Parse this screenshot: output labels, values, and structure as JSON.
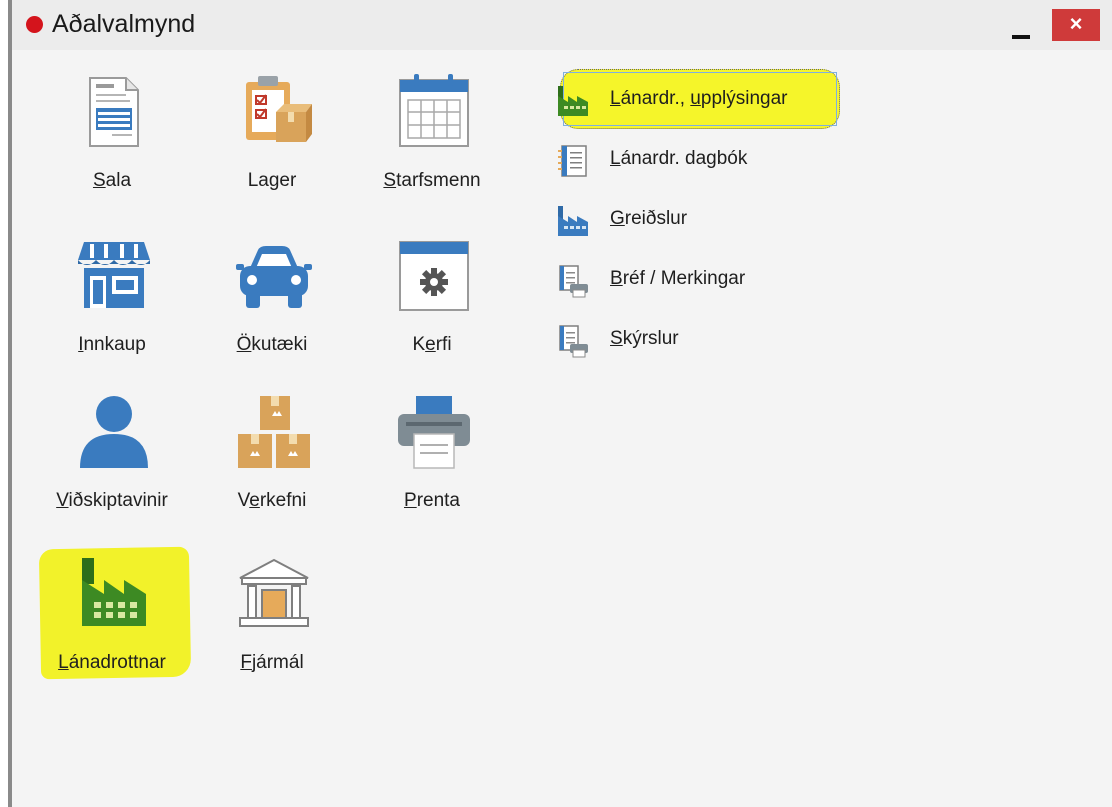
{
  "window": {
    "title": "Aðalvalmynd",
    "minimize_label": "–",
    "close_label": "×"
  },
  "tiles": [
    {
      "label_pre": "",
      "label_key": "S",
      "label_post": "ala",
      "icon": "order-form-icon"
    },
    {
      "label_pre": "La",
      "label_key": "g",
      "label_post": "er",
      "icon": "inventory-clipboard-icon"
    },
    {
      "label_pre": "",
      "label_key": "S",
      "label_post": "tarfsmenn",
      "icon": "calendar-icon"
    },
    {
      "label_pre": "",
      "label_key": "I",
      "label_post": "nnkaup",
      "icon": "storefront-icon"
    },
    {
      "label_pre": "",
      "label_key": "Ö",
      "label_post": "kutæki",
      "icon": "car-icon"
    },
    {
      "label_pre": "K",
      "label_key": "e",
      "label_post": "rfi",
      "icon": "settings-window-icon"
    },
    {
      "label_pre": "",
      "label_key": "V",
      "label_post": "iðskiptavinir",
      "icon": "user-icon"
    },
    {
      "label_pre": "V",
      "label_key": "e",
      "label_post": "rkefni",
      "icon": "boxes-icon"
    },
    {
      "label_pre": "",
      "label_key": "P",
      "label_post": "renta",
      "icon": "printer-icon"
    },
    {
      "label_pre": "",
      "label_key": "L",
      "label_post": "ánadrottnar",
      "icon": "factory-icon"
    },
    {
      "label_pre": "",
      "label_key": "F",
      "label_post": "jármál",
      "icon": "bank-icon"
    }
  ],
  "links": [
    {
      "pre": "",
      "key": "L",
      "post": "ánardr., ",
      "key2": "u",
      "post2": "pplýsingar",
      "icon": "factory-small-icon",
      "selected": true
    },
    {
      "pre": "",
      "key": "L",
      "post": "ánardr. dagbók",
      "icon": "notebook-icon",
      "selected": false
    },
    {
      "pre": "",
      "key": "G",
      "post": "reiðslur",
      "icon": "factory-small-blue-icon",
      "selected": false
    },
    {
      "pre": "",
      "key": "B",
      "post": "réf / Merkingar",
      "icon": "document-print-icon",
      "selected": false
    },
    {
      "pre": "",
      "key": "S",
      "post": "kýrslur",
      "icon": "report-print-icon",
      "selected": false
    }
  ],
  "colors": {
    "accent_blue": "#3a7bbf",
    "factory_green": "#3d8a23",
    "highlight_yellow": "#f2f22a",
    "box_tan": "#d9a35a",
    "close_red": "#cf3a3a"
  }
}
